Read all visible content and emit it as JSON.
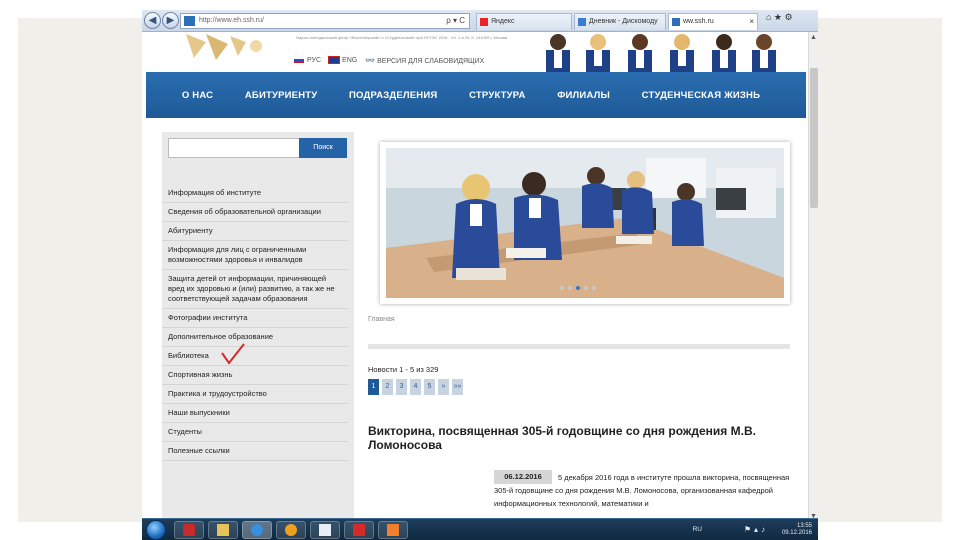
{
  "browser": {
    "back_icon": "back-arrow-icon",
    "forward_icon": "forward-arrow-icon",
    "address": "http://www.eh.ssh.ru/",
    "address_tools": "ρ ▾ C",
    "tabs": [
      {
        "label": "Яндекс",
        "active": false
      },
      {
        "label": "Дневник - Дискомоду",
        "active": false
      },
      {
        "label": "ww.ssh.ru",
        "active": true
      }
    ],
    "window_controls": "⌂ ★ ⚙"
  },
  "header": {
    "note": "Научно-методический центр «Волонтёрский» и «Студенческий» при НГУЭУ, 2016 · Ул. 1-я 20, 8, 141000 г. Москва",
    "lang_ru": "РУС",
    "lang_en": "ENG",
    "low_vision": "ВЕРСИЯ ДЛЯ СЛАБОВИДЯЩИХ"
  },
  "nav": {
    "items": [
      "О НАС",
      "АБИТУРИЕНТУ",
      "ПОДРАЗДЕЛЕНИЯ",
      "СТРУКТУРА",
      "ФИЛИАЛЫ",
      "СТУДЕНЧЕСКАЯ ЖИЗНЬ"
    ]
  },
  "sidebar": {
    "search_placeholder": "",
    "search_button": "Поиск",
    "menu": [
      "Информация об институте",
      "Сведения об образовательной организации",
      "Абитуриенту",
      "Информация для лиц с ограниченными возможностями здоровья и инвалидов",
      "Защита детей от информации, причиняющей вред их здоровью и (или) развитию, а так же не соответствующей задачам образования",
      "Фотографии института",
      "Дополнительное образование",
      "Библиотека",
      "Спортивная жизнь",
      "Практика и трудоустройство",
      "Наши выпускники",
      "Студенты",
      "Полезные ссылки"
    ]
  },
  "content": {
    "breadcrumb": "Главная",
    "news_count": "Новости 1 - 5 из 329",
    "pager": [
      "1",
      "2",
      "3",
      "4",
      "5",
      "»",
      "»»"
    ],
    "pager_active": "1",
    "headline": "Викторина, посвященная 305-й годовщине со дня рождения М.В. Ломоносова",
    "date": "06.12.2016",
    "text": "5 декабря 2016 года в институте прошла викторина, посвященная 305-й годовщине со дня рождения М.В. Ломоносова, организованная кафедрой информационных технологий, математики и"
  },
  "taskbar": {
    "lang": "RU",
    "time": "13:55",
    "date": "09.12.2016"
  },
  "colors": {
    "nav_blue": "#2266aa",
    "accent": "#2563a8",
    "check_mark": "#d62a2a"
  }
}
